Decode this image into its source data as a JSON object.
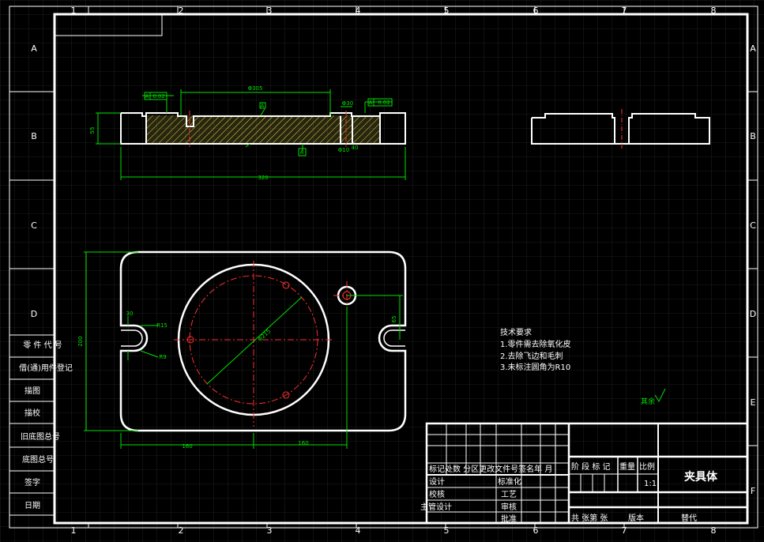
{
  "frame": {
    "col_numbers": [
      "1",
      "2",
      "3",
      "4",
      "5",
      "6",
      "7",
      "8"
    ],
    "row_letters": [
      "A",
      "B",
      "C",
      "D",
      "E",
      "F"
    ]
  },
  "left_stack": [
    "零 件 代 号",
    "借(通)用件登记",
    "描图",
    "描校",
    "旧底图总号",
    "底图总号",
    "签字",
    "日期"
  ],
  "dims": {
    "top_diameter": "Φ305",
    "hole_small": "Φ30",
    "height_left": "55",
    "length_total": "320",
    "bottom_left": "Φ10",
    "bottom_right": "40",
    "plan_height": "200",
    "plan_r_slot": "R15",
    "plan_slot_width": "30",
    "plan_r_corner": "R9",
    "plan_dia": "Φ215",
    "plan_left_half": "160",
    "plan_right_half": "160",
    "plan_right_dim": "65"
  },
  "tolerances": {
    "flat_left_letter": "A",
    "flat_left_value": "0.02",
    "perp_right_letter": "A",
    "perp_right_value": "0.02",
    "datum_a": "A",
    "datum_bottom": "A"
  },
  "notes": {
    "heading": "技术要求",
    "line1": "1.零件需去除氧化皮",
    "line2": "2.去除飞边和毛刺",
    "line3": "3.未标注圆角为R10"
  },
  "roughness": "其余",
  "title_block": {
    "part_name": "夹具体",
    "header_row": "标记处数  分区更改文件号签名年  月",
    "stage_header": "阶 段 标 记",
    "weight": "重量",
    "scale_label": "比例",
    "scale_value": "1:1",
    "sheets": "共  张第  张",
    "version": "版本",
    "replace": "替代",
    "design": "设计",
    "standardize": "标准化",
    "check": "校核",
    "process": "工艺",
    "chief_design": "主管设计",
    "review": "审核",
    "approve": "批准"
  },
  "colors": {
    "background": "#000000",
    "outline": "#ffffff",
    "dimension": "#00ff00",
    "centerline": "#ff0000",
    "hatch": "#ffff66",
    "grid": "#3a3a3a"
  }
}
